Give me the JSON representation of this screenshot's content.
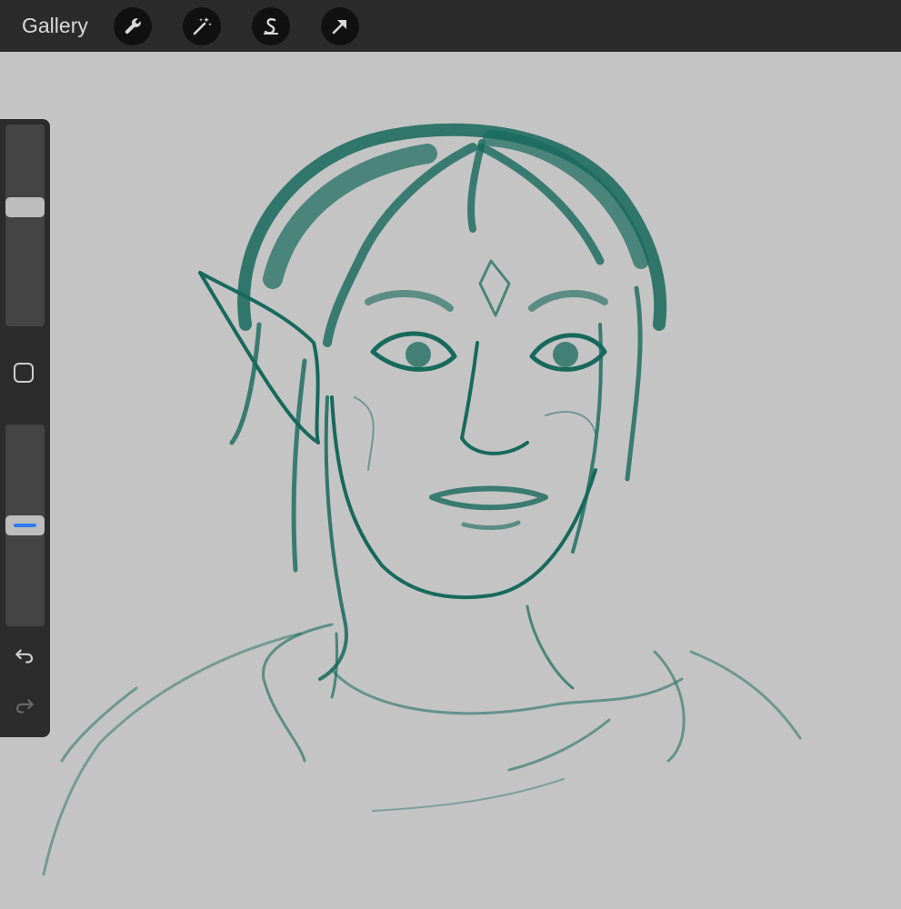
{
  "topbar": {
    "gallery_label": "Gallery",
    "tools": [
      "wrench-icon",
      "magic-wand-icon",
      "selection-s-icon",
      "transform-arrow-icon"
    ],
    "icon_color": "#d8d8d8",
    "button_color": "#111111"
  },
  "sidebar": {
    "brush_size_level": 0.6,
    "opacity_level": 0.5,
    "accent_color": "#2f7bf5",
    "buttons": [
      "modify-square-icon",
      "undo-icon",
      "redo-icon"
    ]
  },
  "canvas": {
    "background_color": "#c4c4c4",
    "stroke_color": "#17695c"
  }
}
